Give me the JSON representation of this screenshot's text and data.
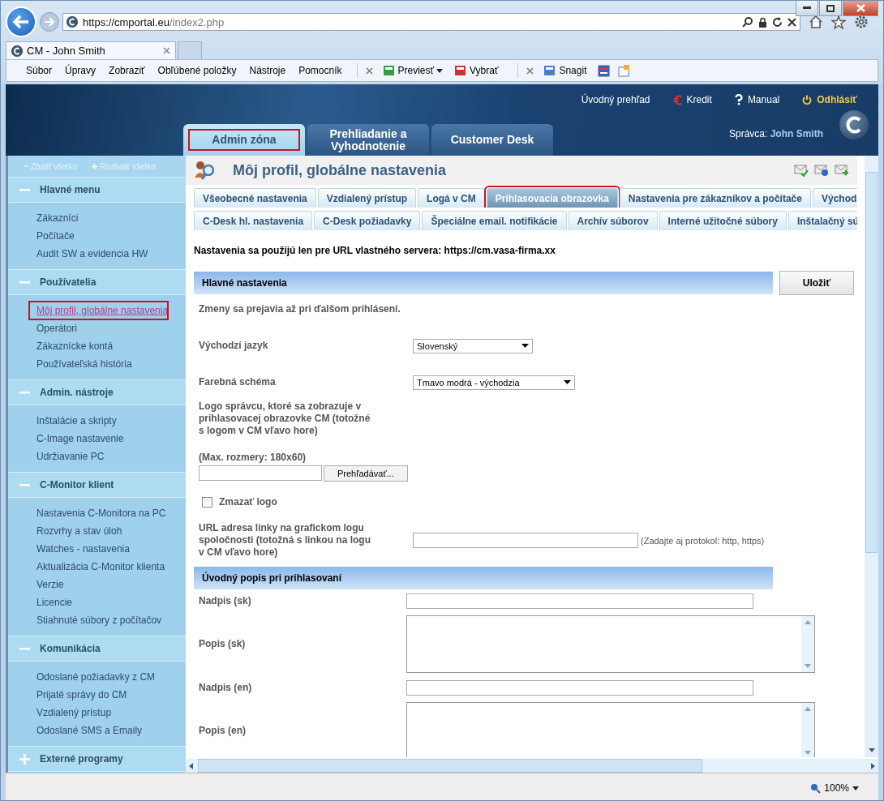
{
  "browser": {
    "url_host": "https://cmportal.eu",
    "url_path": "/index2.php",
    "tab_title": "CM - John Smith",
    "menu": [
      "Súbor",
      "Úpravy",
      "Zobraziť",
      "Obľúbené položky",
      "Nástroje",
      "Pomocník"
    ],
    "toolbar": [
      {
        "label": "Previesť",
        "kind": "convert"
      },
      {
        "label": "Vybrať",
        "kind": "select"
      },
      {
        "label": "Snagit",
        "kind": "snagit"
      }
    ],
    "zoom": "100%"
  },
  "header": {
    "links": [
      {
        "label": "Úvodný prehľad",
        "kind": "home"
      },
      {
        "label": "Kredit",
        "kind": "credit"
      },
      {
        "label": "Manual",
        "kind": "help"
      },
      {
        "label": "Odhlásiť",
        "kind": "logout"
      }
    ],
    "main_tabs": [
      {
        "label": "Admin zóna",
        "selected": true
      },
      {
        "label": "Prehliadanie a Vyhodnotenie",
        "selected": false
      },
      {
        "label": "Customer Desk",
        "selected": false
      }
    ],
    "admin_label": "Správca:",
    "admin_name": "John Smith"
  },
  "sidebar": {
    "collapse_all": "Zbaliť všetko",
    "expand_all": "Rozbaliť všetko",
    "sections": [
      {
        "title": "Hlavné menu",
        "expanded": true,
        "items": [
          {
            "label": "Zákazníci",
            "selected": false
          },
          {
            "label": "Počítače",
            "selected": false
          },
          {
            "label": "Audit SW a evidencia HW",
            "selected": false
          }
        ]
      },
      {
        "title": "Používatelia",
        "expanded": true,
        "items": [
          {
            "label": "Môj profil, globálne nastavenia",
            "selected": true
          },
          {
            "label": "Operátori",
            "selected": false
          },
          {
            "label": "Zákaznícke kontá",
            "selected": false
          },
          {
            "label": "Používateľská história",
            "selected": false
          }
        ]
      },
      {
        "title": "Admin. nástroje",
        "expanded": true,
        "items": [
          {
            "label": "Inštalácie a skripty",
            "selected": false
          },
          {
            "label": "C-Image nastavenie",
            "selected": false
          },
          {
            "label": "Udržiavanie PC",
            "selected": false
          }
        ]
      },
      {
        "title": "C-Monitor klient",
        "expanded": true,
        "items": [
          {
            "label": "Nastavenia C-Monitora na PC",
            "selected": false
          },
          {
            "label": "Rozvrhy a stav úloh",
            "selected": false
          },
          {
            "label": "Watches - nastavenia",
            "selected": false
          },
          {
            "label": "Aktualizácia C-Monitor klienta",
            "selected": false
          },
          {
            "label": "Verzie",
            "selected": false
          },
          {
            "label": "Licencie",
            "selected": false
          },
          {
            "label": "Stiahnuté súbory z počítačov",
            "selected": false
          }
        ]
      },
      {
        "title": "Komunikácia",
        "expanded": true,
        "items": [
          {
            "label": "Odoslané požiadavky z CM",
            "selected": false
          },
          {
            "label": "Prijaté správy do CM",
            "selected": false
          },
          {
            "label": "Vzdialený prístup",
            "selected": false
          },
          {
            "label": "Odoslané SMS a Emaily",
            "selected": false
          }
        ]
      },
      {
        "title": "Externé programy",
        "expanded": false
      }
    ]
  },
  "page": {
    "title": "Môj profil, globálne nastavenia",
    "tab_rows": [
      [
        {
          "label": "Všeobecné nastavenia",
          "selected": false
        },
        {
          "label": "Vzdialený prístup",
          "selected": false
        },
        {
          "label": "Logá v CM",
          "selected": false
        },
        {
          "label": "Prihlasovacia obrazovka",
          "selected": true
        },
        {
          "label": "Nastavenia pre zákazníkov a počítače",
          "selected": false
        },
        {
          "label": "Východ",
          "selected": false
        }
      ],
      [
        {
          "label": "C-Desk hl. nastavenia",
          "selected": false
        },
        {
          "label": "C-Desk požiadavky",
          "selected": false
        },
        {
          "label": "Špeciálne email. notifikácie",
          "selected": false
        },
        {
          "label": "Archív súborov",
          "selected": false
        },
        {
          "label": "Interné užitočné súbory",
          "selected": false
        },
        {
          "label": "Inštalačný sú",
          "selected": false
        }
      ]
    ],
    "notice": "Nastavenia sa použijú len pre URL vlastného servera: https://cm.vasa-firma.xx",
    "save": "Uložiť",
    "sections": [
      {
        "title": "Hlavné nastavenia",
        "note": "Zmeny sa prejavia až pri ďalšom prihlásení.",
        "fields": [
          {
            "kind": "select",
            "label": "Východzí jazyk",
            "value": "Slovenský"
          },
          {
            "kind": "select",
            "label": "Farebná schéma",
            "value": "Tmavo modrá - východzia"
          },
          {
            "kind": "file",
            "label": "Logo správcu, ktoré sa zobrazuje v prihlasovacej obrazovke CM (totožné s logom v CM vľavo hore)",
            "hint": "(Max. rozmery: 180x60)",
            "button": "Prehľadávať..."
          },
          {
            "kind": "checkbox",
            "label": "Zmazať logo",
            "checked": false
          },
          {
            "kind": "text",
            "label": "URL adresa linky na grafickom logu spoločnosti (totožná s linkou na logu v CM vľavo hore)",
            "hint": "(Zadajte aj protokol: http, https)"
          }
        ]
      },
      {
        "title": "Úvodný popis pri prihlasovaní",
        "fields": [
          {
            "kind": "text",
            "label": "Nadpis (sk)"
          },
          {
            "kind": "textarea",
            "label": "Popis (sk)"
          },
          {
            "kind": "text",
            "label": "Nadpis (en)"
          },
          {
            "kind": "textarea",
            "label": "Popis (en)"
          }
        ]
      }
    ]
  }
}
